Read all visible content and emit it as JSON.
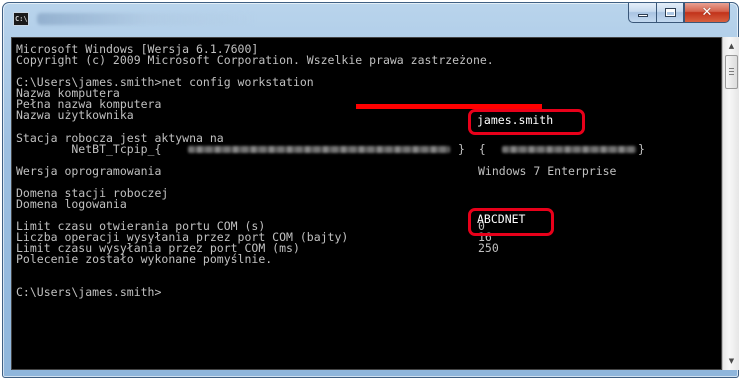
{
  "window": {
    "icon_text": "C:\\",
    "caption_buttons": {
      "minimize": "—",
      "maximize": "□",
      "close": "✕"
    },
    "accent_color": "#e8001a"
  },
  "console": {
    "lines": [
      "Microsoft Windows [Wersja 6.1.7600]",
      "Copyright (c) 2009 Microsoft Corporation. Wszelkie prawa zastrzeżone.",
      "",
      "C:\\Users\\james.smith>net config workstation",
      "Nazwa komputera",
      "Pełna nazwa komputera",
      "Nazwa użytkownika",
      "",
      "Stacja robocza jest aktywna na",
      "        NetBT_Tcpip_{",
      "",
      "Wersja oprogramowania",
      "",
      "Domena stacji roboczej",
      "Domena logowania",
      "",
      "Limit czasu otwierania portu COM (s)",
      "Liczba operacji wysyłania przez port COM (bajty)",
      "Limit czasu wysyłania przez port COM (ms)",
      "Polecenie zostało wykonane pomyślnie.",
      "",
      "",
      "C:\\Users\\james.smith>"
    ],
    "values": {
      "user_name": "james.smith",
      "software_version": "Windows 7 Enterprise",
      "workstation_domain": "ABCDNET",
      "com_open_timeout": "0",
      "com_send_bytes": "16",
      "com_send_timeout": "250"
    },
    "net_adapter_suffix": "}  {",
    "net_adapter_end": "}"
  },
  "scrollbar": {
    "up_arrow": "▲",
    "down_arrow": "▼"
  }
}
